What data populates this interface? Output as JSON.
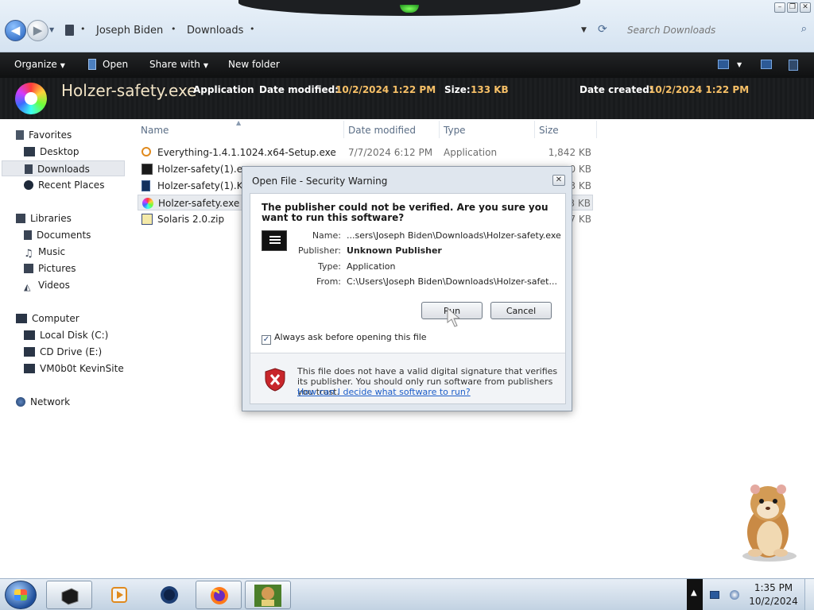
{
  "address_bar": {
    "breadcrumbs": [
      "Joseph Biden",
      "Downloads"
    ],
    "search_placeholder": "Search Downloads"
  },
  "toolbar": {
    "organize": "Organize",
    "open": "Open",
    "share_with": "Share with",
    "new_folder": "New folder"
  },
  "details": {
    "file_name": "Holzer-safety.exe",
    "type": "Application",
    "date_modified_label": "Date modified:",
    "date_modified_value": "10/2/2024 1:22 PM",
    "size_label": "Size:",
    "size_value": "133 KB",
    "date_created_label": "Date created:",
    "date_created_value": "10/2/2024 1:22 PM"
  },
  "nav": {
    "favorites": "Favorites",
    "desktop": "Desktop",
    "downloads": "Downloads",
    "recent_places": "Recent Places",
    "libraries": "Libraries",
    "documents": "Documents",
    "music": "Music",
    "pictures": "Pictures",
    "videos": "Videos",
    "computer": "Computer",
    "local_disk": "Local Disk (C:)",
    "cd_drive": "CD Drive (E:)",
    "vm_share": "VM0b0t KevinSite",
    "network": "Network"
  },
  "columns": {
    "name": "Name",
    "date_modified": "Date modified",
    "type": "Type",
    "size": "Size"
  },
  "files": [
    {
      "name": "Everything-1.4.1.1024.x64-Setup.exe",
      "date": "7/7/2024 6:12 PM",
      "type": "Application",
      "size": "1,842 KB"
    },
    {
      "name": "Holzer-safety(1).exe",
      "date": "",
      "type": "",
      "size": "0 KB"
    },
    {
      "name": "Holzer-safety(1).KvJl",
      "date": "",
      "type": "",
      "size": "3 KB"
    },
    {
      "name": "Holzer-safety.exe",
      "date": "",
      "type": "",
      "size": "3 KB"
    },
    {
      "name": "Solaris 2.0.zip",
      "date": "",
      "type": "",
      "size": "7 KB"
    }
  ],
  "dialog": {
    "title": "Open File - Security Warning",
    "heading": "The publisher could not be verified.  Are you sure you want to run this software?",
    "name_label": "Name:",
    "name_value": "...sers\\Joseph Biden\\Downloads\\Holzer-safety.exe",
    "publisher_label": "Publisher:",
    "publisher_value": "Unknown Publisher",
    "type_label": "Type:",
    "type_value": "Application",
    "from_label": "From:",
    "from_value": "C:\\Users\\Joseph Biden\\Downloads\\Holzer-safet...",
    "run_button": "Run",
    "cancel_button": "Cancel",
    "checkbox_label": "Always ask before opening this file",
    "checkbox_checked": true,
    "warning_text": "This file does not have a valid digital signature that verifies its publisher.  You should only run software from publishers you trust.",
    "warning_link": "How can I decide what software to run?"
  },
  "taskbar": {
    "clock_time": "1:35 PM",
    "clock_date": "10/2/2024"
  }
}
